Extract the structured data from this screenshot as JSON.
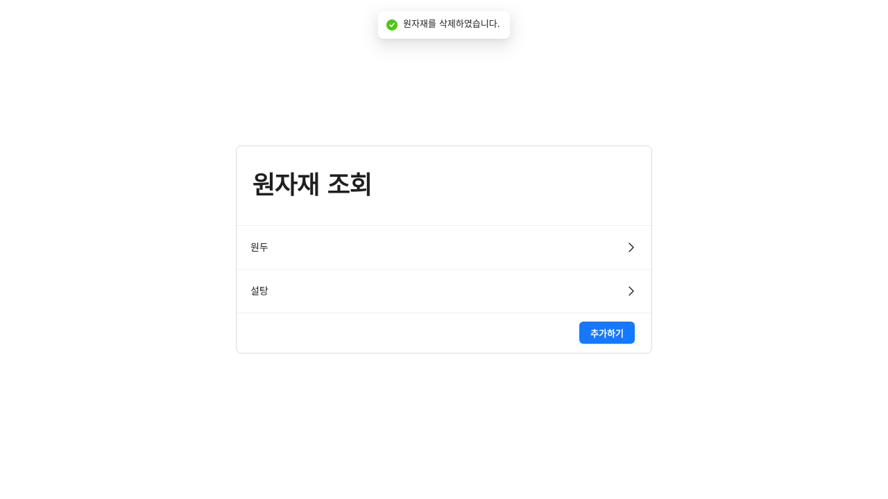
{
  "toast": {
    "icon": "check-circle-icon",
    "icon_color": "#52c41a",
    "message": "원자재를 삭제하였습니다."
  },
  "card": {
    "title": "원자재 조회",
    "items": [
      {
        "label": "원두",
        "icon": "chevron-right-icon"
      },
      {
        "label": "설탕",
        "icon": "chevron-right-icon"
      }
    ],
    "add_button_label": "추가하기",
    "accent_color": "#1677ff"
  }
}
